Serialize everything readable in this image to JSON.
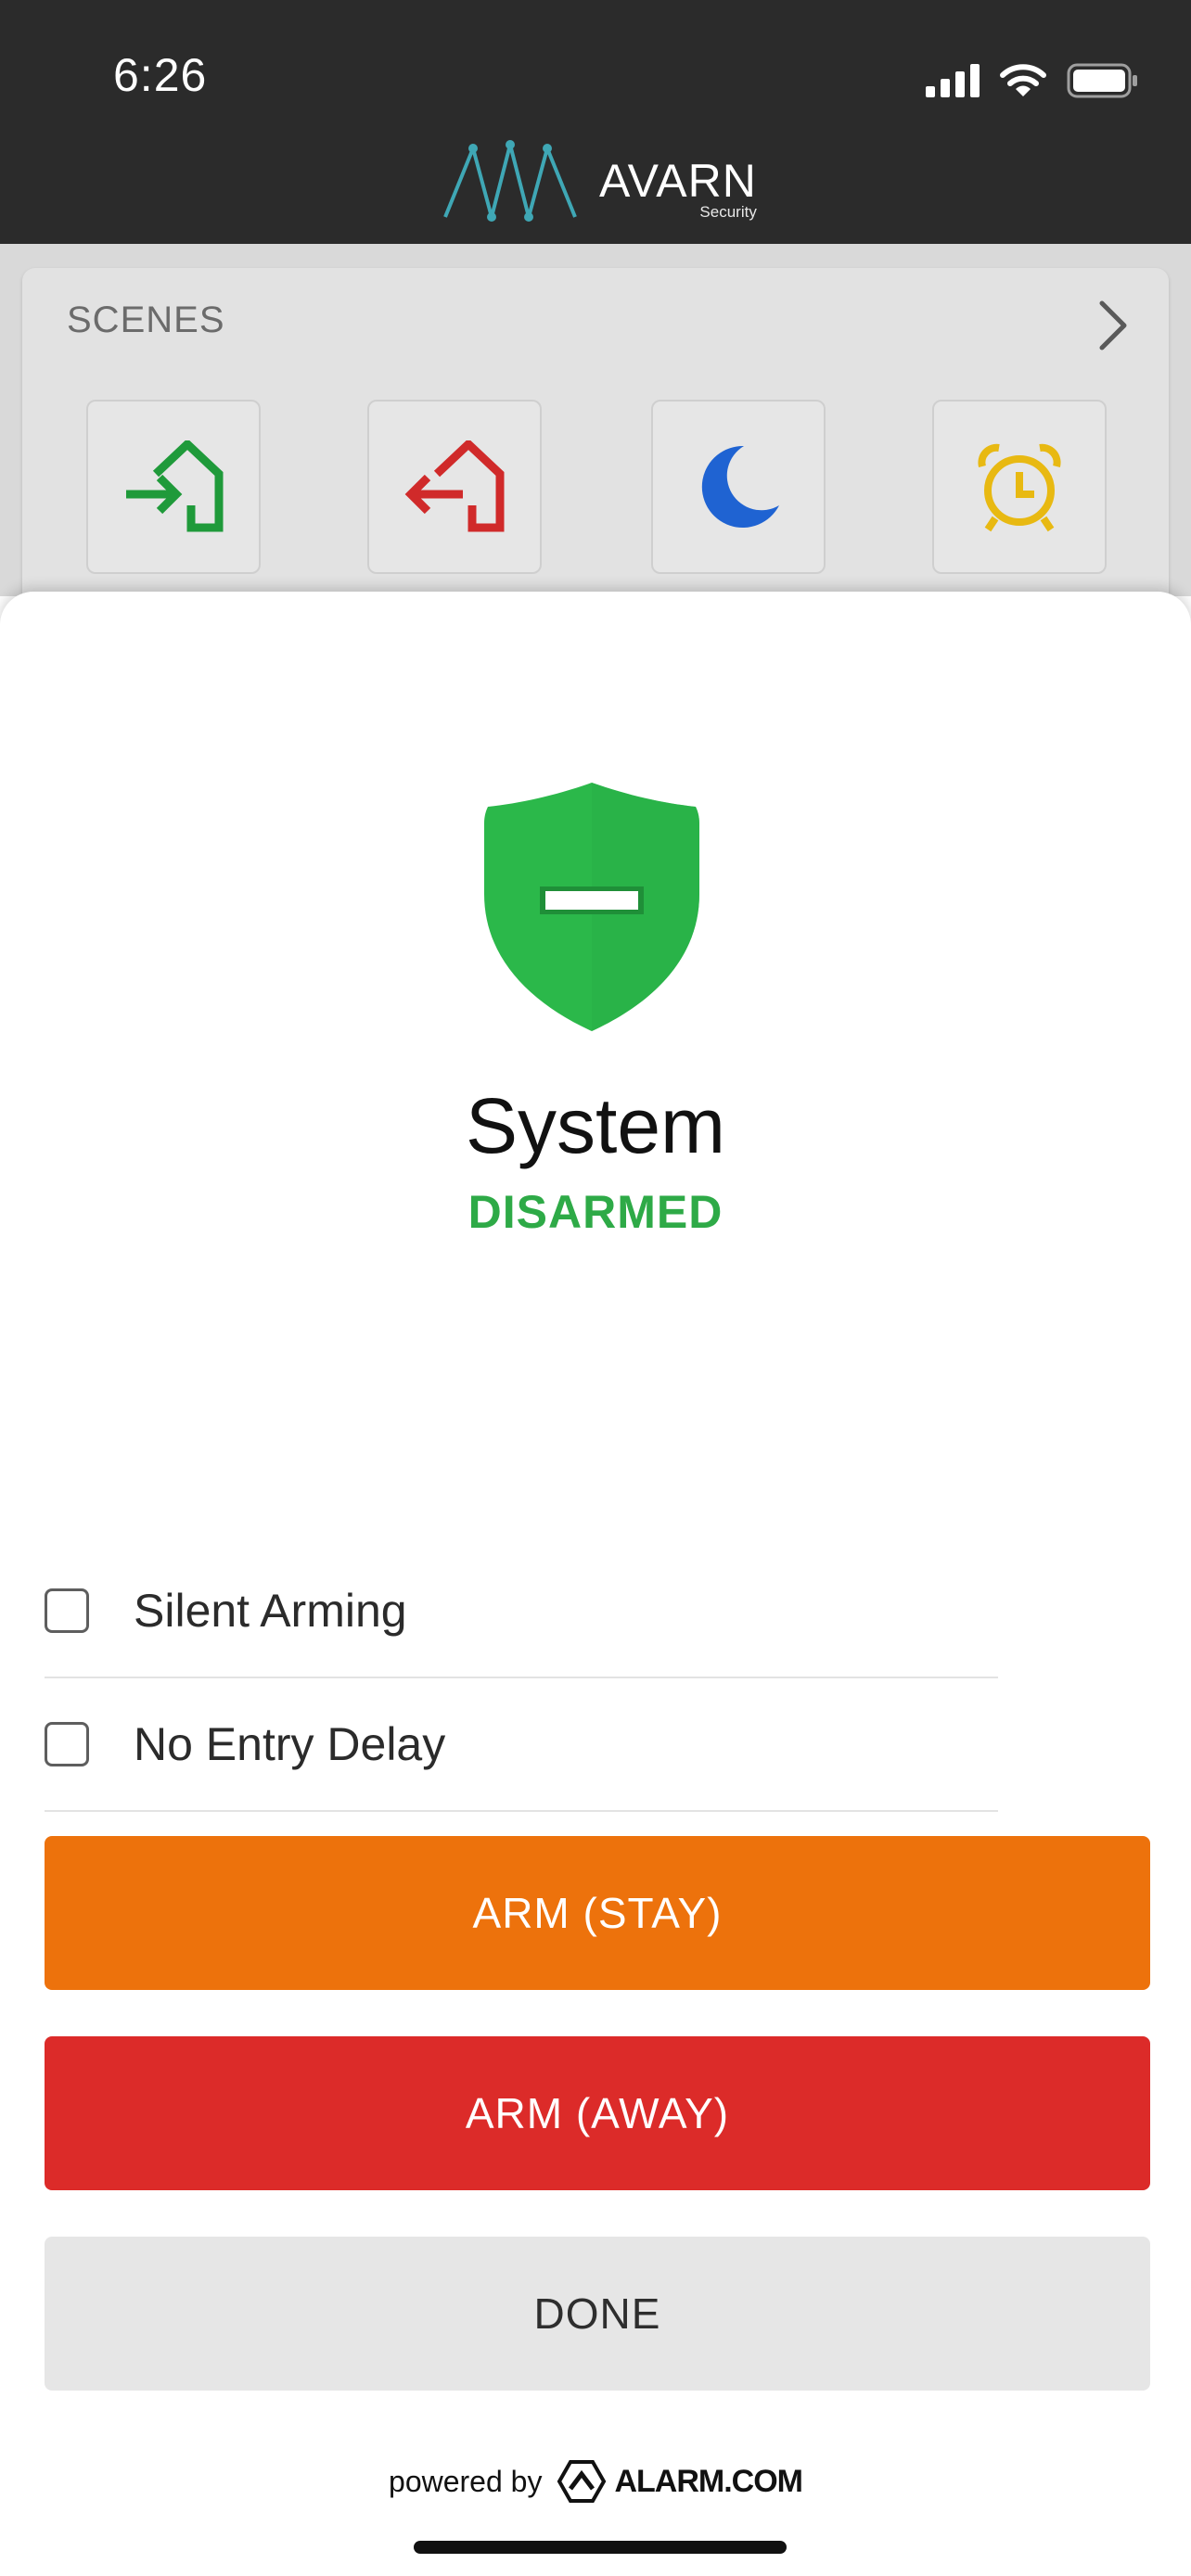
{
  "status_bar": {
    "time": "6:26"
  },
  "brand": {
    "name": "AVARN",
    "subtitle": "Security",
    "logo_color": "#3fa7b5"
  },
  "scenes": {
    "title": "SCENES",
    "items": [
      {
        "name": "arrive-home",
        "icon": "house-arrow-in-icon",
        "color": "#1f9a3a"
      },
      {
        "name": "leave-home",
        "icon": "house-arrow-out-icon",
        "color": "#d02a2a"
      },
      {
        "name": "night",
        "icon": "moon-icon",
        "color": "#1f63d2"
      },
      {
        "name": "wake-up",
        "icon": "alarm-clock-icon",
        "color": "#e8b912"
      }
    ]
  },
  "system": {
    "title": "System",
    "status": "DISARMED",
    "status_color": "#2eaa47",
    "shield_color": "#2bb84a"
  },
  "options": [
    {
      "label": "Silent Arming",
      "checked": false
    },
    {
      "label": "No Entry Delay",
      "checked": false
    }
  ],
  "actions": {
    "arm_stay": "ARM (STAY)",
    "arm_away": "ARM (AWAY)",
    "done": "DONE"
  },
  "footer": {
    "powered_by": "powered by",
    "provider": "ALARM.COM"
  }
}
